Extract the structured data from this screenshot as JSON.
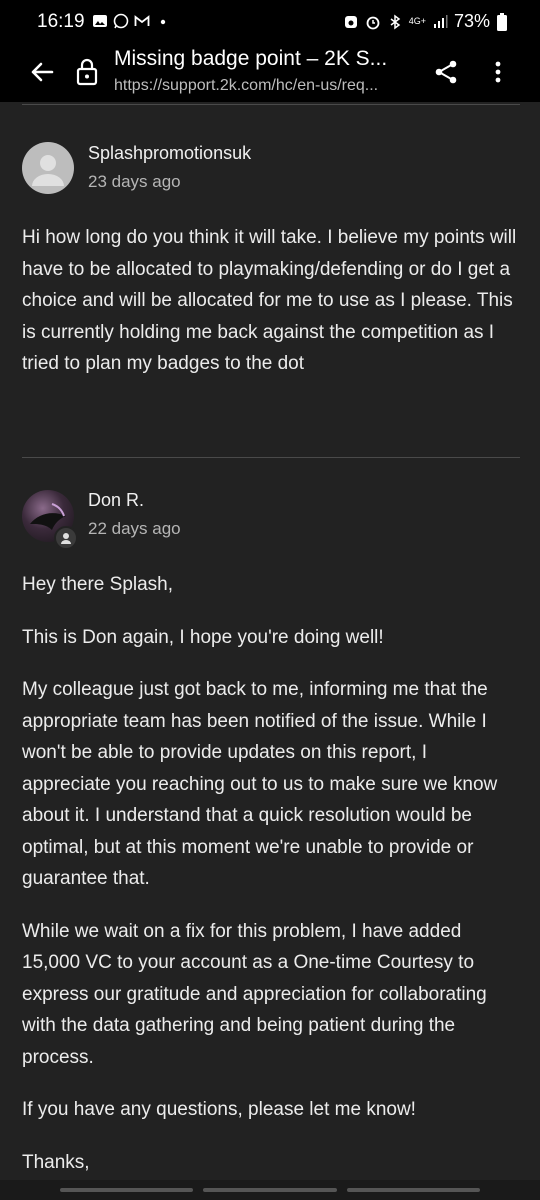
{
  "status_bar": {
    "time": "16:19",
    "network": "4G+",
    "battery": "73%"
  },
  "toolbar": {
    "title": "Missing badge point – 2K S...",
    "url": "https://support.2k.com/hc/en-us/req..."
  },
  "comments": [
    {
      "author": "Splashpromotionsuk",
      "date": "23 days ago",
      "paragraphs": [
        "Hi how long do you think it will take. I believe my points will have to be allocated to playmaking/defending or do I get a choice and will be allocated for me to use as I please. This is currently holding me back against the competition as I tried to plan my badges to the dot"
      ]
    },
    {
      "author": "Don R.",
      "date": "22 days ago",
      "paragraphs": [
        "Hey there Splash,",
        "This is Don again, I hope you're doing well!",
        "My colleague just got back to me, informing me that the appropriate team has been notified of the issue. While I won't be able to provide updates on this report, I appreciate you reaching out to us to make sure we know about it. I understand that a quick resolution would be optimal, but at this moment we're unable to provide or guarantee that.",
        "While we wait on a fix for this problem, I have added 15,000 VC to your account as a One-time Courtesy to express our gratitude and appreciation for collaborating with the data gathering and being patient during the process.",
        "If you have any questions, please let me know!",
        "Thanks,"
      ]
    }
  ],
  "colors": {
    "background": "#222222",
    "bar": "#000000",
    "text": "#ececec",
    "muted": "#b5b5b5"
  }
}
